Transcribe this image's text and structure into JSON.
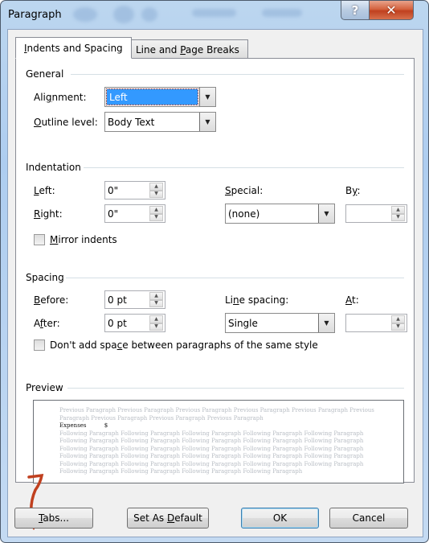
{
  "window": {
    "title": "Paragraph",
    "help_icon": "help-question-icon",
    "close_icon": "close-x-icon"
  },
  "tabs": [
    {
      "label_pre": "",
      "accel": "I",
      "label_post": "ndents and Spacing",
      "active": true
    },
    {
      "label_pre": "Line and ",
      "accel": "P",
      "label_post": "age Breaks",
      "active": false
    }
  ],
  "general": {
    "title": "General",
    "alignment": {
      "label_pre": "Ali",
      "accel": "g",
      "label_post": "nment:",
      "value": "Left"
    },
    "outline_level": {
      "label_pre": "",
      "accel": "O",
      "label_post": "utline level:",
      "value": "Body Text"
    }
  },
  "indentation": {
    "title": "Indentation",
    "left": {
      "label_pre": "",
      "accel": "L",
      "label_post": "eft:",
      "value": "0\""
    },
    "right": {
      "label_pre": "",
      "accel": "R",
      "label_post": "ight:",
      "value": "0\""
    },
    "special": {
      "label_pre": "",
      "accel": "S",
      "label_post": "pecial:",
      "value": "(none)"
    },
    "by": {
      "label_pre": "B",
      "accel": "y",
      "label_post": ":",
      "value": ""
    },
    "mirror": {
      "label_pre": "",
      "accel": "M",
      "label_post": "irror indents",
      "checked": false
    }
  },
  "spacing": {
    "title": "Spacing",
    "before": {
      "label_pre": "",
      "accel": "B",
      "label_post": "efore:",
      "value": "0 pt"
    },
    "after": {
      "label_pre": "A",
      "accel": "f",
      "label_post": "ter:",
      "value": "0 pt"
    },
    "line_spacing": {
      "label_pre": "Li",
      "accel": "n",
      "label_post": "e spacing:",
      "value": "Single"
    },
    "at": {
      "label_pre": "",
      "accel": "A",
      "label_post": "t:",
      "value": ""
    },
    "dont_add": {
      "label_pre": "Don't add spa",
      "accel": "c",
      "label_post": "e between paragraphs of the same style",
      "checked": false
    }
  },
  "preview": {
    "title": "Preview",
    "previous_text": "Previous Paragraph Previous Paragraph Previous Paragraph Previous Paragraph Previous Paragraph Previous Paragraph Previous Paragraph Previous Paragraph Previous Paragraph",
    "current_text": "Expenses          $",
    "following_text": "Following Paragraph Following Paragraph Following Paragraph Following Paragraph Following Paragraph Following Paragraph Following Paragraph Following Paragraph Following Paragraph Following Paragraph Following Paragraph Following Paragraph Following Paragraph Following Paragraph Following Paragraph Following Paragraph Following Paragraph Following Paragraph Following Paragraph Following Paragraph Following Paragraph Following Paragraph Following Paragraph Following Paragraph Following Paragraph Following Paragraph Following Paragraph Following Paragraph Following Paragraph"
  },
  "buttons": {
    "tabs": {
      "label_pre": "",
      "accel": "T",
      "label_post": "abs..."
    },
    "set_default": {
      "label_pre": "Set As ",
      "accel": "D",
      "label_post": "efault"
    },
    "ok": {
      "label": "OK"
    },
    "cancel": {
      "label": "Cancel"
    }
  },
  "colors": {
    "annotation_arrow": "#c0401f",
    "selection": "#3399ff"
  }
}
